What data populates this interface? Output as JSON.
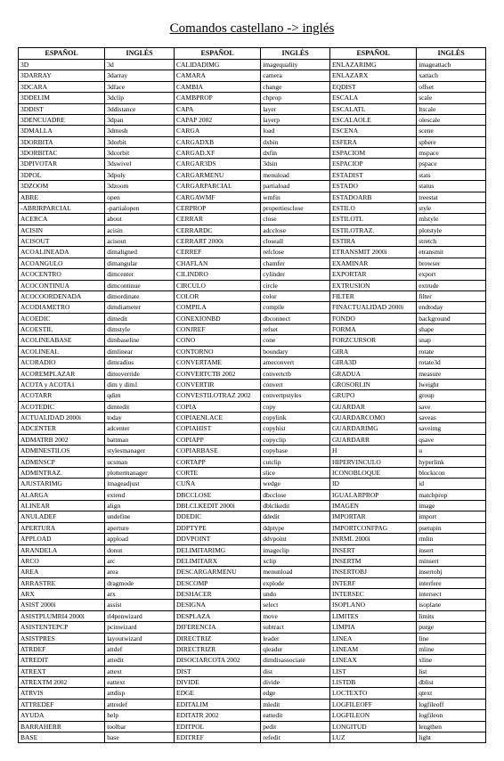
{
  "title": "Comandos castellano -> inglés",
  "headers": [
    "ESPAÑOL",
    "INGLÉS",
    "ESPAÑOL",
    "INGLÉS",
    "ESPAÑOL",
    "INGLÉS"
  ],
  "rows": [
    [
      "3D",
      "3d",
      "CALIDADIMG",
      "imagequality",
      "ENLAZARIMG",
      "imageattach"
    ],
    [
      "3DARRAY",
      "3darray",
      "CAMARA",
      "camera",
      "ENLAZARX",
      "xattach"
    ],
    [
      "3DCARA",
      "3dface",
      "CAMBIA",
      "change",
      "EQDIST",
      "offset"
    ],
    [
      "3DDELIM",
      "3dclip",
      "CAMBPROP",
      "chprop",
      "ESCALA",
      "scale"
    ],
    [
      "3DDIST",
      "3ddistance",
      "CAPA",
      "layer",
      "ESCALATL",
      "ltscale"
    ],
    [
      "3DENCUADRE",
      "3dpan",
      "CAPAP 2002",
      "layerp",
      "ESCALAOLE",
      "olescale"
    ],
    [
      "3DMALLA",
      "3dmesh",
      "CARGA",
      "load",
      "ESCENA",
      "scene"
    ],
    [
      "3DORBITA",
      "3dorbit",
      "CARGADXB",
      "dxbin",
      "ESFERA",
      "sphere"
    ],
    [
      "3DORBITAC",
      "3dcorbit",
      "CARGAD.XF",
      "dxfin",
      "ESPACIOM",
      "mspace"
    ],
    [
      "3DPIVOTAR",
      "3dswivel",
      "CARGAR3DS",
      "3dsin",
      "ESPACIOP",
      "pspace"
    ],
    [
      "3DPOL",
      "3dpoly",
      "CARGARMENU",
      "menuload",
      "ESTADIST",
      "stats"
    ],
    [
      "3DZOOM",
      "3dzoom",
      "CARGARPARCIAL",
      "partiaload",
      "ESTADO",
      "status"
    ],
    [
      "ABRE",
      "open",
      "CARGAWMF",
      "wmfin",
      "ESTADOARB",
      "treestat"
    ],
    [
      "-ABRIRPARCIAL",
      "-partialopen",
      "CERPROP",
      "propertiesclose",
      "ESTILO",
      "style"
    ],
    [
      "ACERCA",
      "about",
      "CERRAR",
      "close",
      "ESTILOTL",
      "mlstyle"
    ],
    [
      "ACISIN",
      "acisin",
      "CERRARDC",
      "adcclose",
      "ESTILOTRAZ.",
      "plotstyle"
    ],
    [
      "ACISOUT",
      "acisout",
      "CERRART 2000i",
      "closeall",
      "ESTIRA",
      "stretch"
    ],
    [
      "ACOALINEADA",
      "dimaligned",
      "CERREF",
      "refclose",
      "ETRANSMIT 2000i",
      "etransmit"
    ],
    [
      "ACOANGULO",
      "dimangular",
      "CHAFLAN",
      "chamfer",
      "EXAMINAR",
      "browser"
    ],
    [
      "ACOCENTRO",
      "dimcenter",
      "CILINDRO",
      "cylinder",
      "EXPORTAR",
      "export"
    ],
    [
      "ACOCONTINUA",
      "dimcontinue",
      "CIRCULO",
      "circle",
      "EXTRUSION",
      "extrude"
    ],
    [
      "ACOCOORDENADA",
      "dimordinate",
      "COLOR",
      "color",
      "FILTER",
      "filter"
    ],
    [
      "ACODIAMETRO",
      "dimdiameter",
      "COMPILA",
      "compile",
      "FINACTUALIDAD 2000i",
      "endtoday"
    ],
    [
      "ACOEDIC",
      "dimedit",
      "CONEXIONBD",
      "dbconnect",
      "FONDO",
      "background"
    ],
    [
      "ACOESTIL",
      "dimstyle",
      "CONJREF",
      "refset",
      "FORMA",
      "shape"
    ],
    [
      "ACOLINEABASE",
      "dimbaseline",
      "CONO",
      "cone",
      "FORZCURSOR",
      "snap"
    ],
    [
      "ACOLINEAL",
      "dimlinear",
      "CONTORNO",
      "boundary",
      "GIRA",
      "rotate"
    ],
    [
      "ACORADIO",
      "dimradius",
      "CONVERTAME",
      "ameconvert",
      "GIRA3D",
      "rotate3d"
    ],
    [
      "ACOREMPLAZAR",
      "dimoverride",
      "CONVERTCTB 2002",
      "convertctb",
      "GRADUA",
      "measure"
    ],
    [
      "ACOTA y ACOTA1",
      "dim y dim1",
      "CONVERTIR",
      "convert",
      "GROSORLIN",
      "lweight"
    ],
    [
      "ACOTARR",
      "qdim",
      "CONVESTILOTRAZ 2002",
      "convertpstyles",
      "GRUPO",
      "group"
    ],
    [
      "ACOTEDIC",
      "dimtedit",
      "COPIA",
      "copy",
      "GUARDAR",
      "save"
    ],
    [
      "ACTUALIDAD 2000i",
      "today",
      "COPIAENLACE",
      "copylink",
      "GUARDARCOMO",
      "saveas"
    ],
    [
      "ADCENTER",
      "adcenter",
      "COPIAHIST",
      "copyhist",
      "GUARDARIMG",
      "saveimg"
    ],
    [
      "ADMATRB 2002",
      "battman",
      "COPIAPP",
      "copyclip",
      "GUARDARR",
      "qsave"
    ],
    [
      "ADMINESTILOS",
      "stylesmanager",
      "COPIARBASE",
      "copybase",
      "H",
      "u"
    ],
    [
      "ADMINSCP",
      "ucsman",
      "CORTAPP",
      "cutclip",
      "HIPERVINCULO",
      "hyperlink"
    ],
    [
      "ADMINTRAZ.",
      "plottermanager",
      "CORTE",
      "slice",
      "ICONOBLOQUE",
      "blockicon"
    ],
    [
      "AJUSTARIMG",
      "imageadjust",
      "CUÑA",
      "wedge",
      "ID",
      "id"
    ],
    [
      "ALARGA",
      "extend",
      "DBCCLOSE",
      "dbcclose",
      "IGUALARPROP",
      "matchprop"
    ],
    [
      "ALINEAR",
      "align",
      "DBLCLKEDIT 2000i",
      "dblclkedit",
      "IMAGEN",
      "image"
    ],
    [
      "ANULADEF",
      "undefine",
      "DDEDIC",
      "ddedit",
      "IMPORTAR",
      "import"
    ],
    [
      "APERTURA",
      "aperture",
      "DDPTYPE",
      "ddptype",
      "IMPORTCONFPAG",
      "psetupin"
    ],
    [
      "APPLOAD",
      "appload",
      "DDVPOINT",
      "ddvpoint",
      "INRML 2000i",
      "rmlin"
    ],
    [
      "ARANDELA",
      "donut",
      "DELIMITARIMG",
      "imageclip",
      "INSERT",
      "insert"
    ],
    [
      "ARCO",
      "arc",
      "DELIMITARX",
      "xclip",
      "INSERTM",
      "minsert"
    ],
    [
      "AREA",
      "area",
      "DESCARGARMENU",
      "menunload",
      "INSERTOBJ",
      "insertobj"
    ],
    [
      "ARRASTRE",
      "dragmode",
      "DESCOMP",
      "explode",
      "INTERF",
      "interfere"
    ],
    [
      "ARX",
      "arx",
      "DESHACER",
      "undo",
      "INTERSEC",
      "intersect"
    ],
    [
      "ASIST 2000i",
      "assist",
      "DESIGNA",
      "select",
      "ISOPLANO",
      "isoplane"
    ],
    [
      "ASISTPLUMRI4 2000i",
      "rl4penwizard",
      "DESPLAZA",
      "move",
      "LIMITES",
      "limits"
    ],
    [
      "ASISTENTEPCP",
      "pcinwizard",
      "DIFERENCIA",
      "subtract",
      "LIMPIA",
      "purge"
    ],
    [
      "ASISTPRES",
      "layoutwizard",
      "DIRECTRIZ",
      "leader",
      "LINEA",
      "line"
    ],
    [
      "ATRDEF",
      "attdef",
      "DIRECTRIZR",
      "qleader",
      "LINEAM",
      "mline"
    ],
    [
      "ATREDIT",
      "attedit",
      "DISOCIARCOTA 2002",
      "dimdisassociate",
      "LINEAX",
      "xline"
    ],
    [
      "ATREXT",
      "attext",
      "DIST",
      "dist",
      "LIST",
      "list"
    ],
    [
      "ATREXTM 2002",
      "eattext",
      "DIVIDE",
      "divide",
      "LISTDB",
      "dblist"
    ],
    [
      "ATRVIS",
      "attdisp",
      "EDGE",
      "edge",
      "LOCTEXTO",
      "qtext"
    ],
    [
      "ATTREDEF",
      "attredef",
      "EDITALIM",
      "mledit",
      "LOGFILEOFF",
      "logfileoff"
    ],
    [
      "AYUDA",
      "help",
      "EDITATR 2002",
      "eattedit",
      "LOGFILEON",
      "logfileon"
    ],
    [
      "BARRAHERR",
      "toolbar",
      "EDITPOL",
      "pedit",
      "LONGITUD",
      "lengthen"
    ],
    [
      "BASE",
      "base",
      "EDITREF",
      "refedit",
      "LUZ",
      "light"
    ]
  ]
}
